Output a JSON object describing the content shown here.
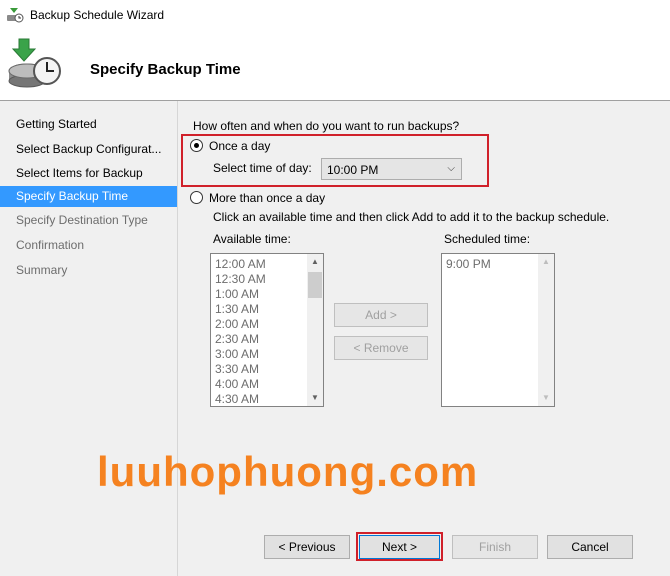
{
  "window": {
    "title": "Backup Schedule Wizard"
  },
  "header": {
    "title": "Specify Backup Time"
  },
  "sidebar": {
    "steps": [
      {
        "label": "Getting Started"
      },
      {
        "label": "Select Backup Configurat..."
      },
      {
        "label": "Select Items for Backup"
      },
      {
        "label": "Specify Backup Time"
      },
      {
        "label": "Specify Destination Type"
      },
      {
        "label": "Confirmation"
      },
      {
        "label": "Summary"
      }
    ],
    "active_step": "Specify Backup Time"
  },
  "main": {
    "question": "How often and when do you want to run backups?",
    "option_once": {
      "label": "Once a day",
      "selected": true
    },
    "time_of_day": {
      "label": "Select time of day:",
      "value": "10:00 PM"
    },
    "option_more": {
      "label": "More than once a day",
      "selected": false
    },
    "instructions": "Click an available time and then click Add to add it to the backup schedule.",
    "available": {
      "label": "Available time:",
      "items": [
        "12:00 AM",
        "12:30 AM",
        "1:00 AM",
        "1:30 AM",
        "2:00 AM",
        "2:30 AM",
        "3:00 AM",
        "3:30 AM",
        "4:00 AM",
        "4:30 AM"
      ]
    },
    "scheduled": {
      "label": "Scheduled time:",
      "items": [
        "9:00 PM"
      ]
    },
    "add_button": "Add >",
    "remove_button": "< Remove"
  },
  "watermark": "luuhophuong.com",
  "footer": {
    "previous": "< Previous",
    "next": "Next >",
    "finish": "Finish",
    "cancel": "Cancel"
  },
  "colors": {
    "accent": "#3399ff",
    "highlight": "#d0202a",
    "watermark": "#f58220"
  }
}
